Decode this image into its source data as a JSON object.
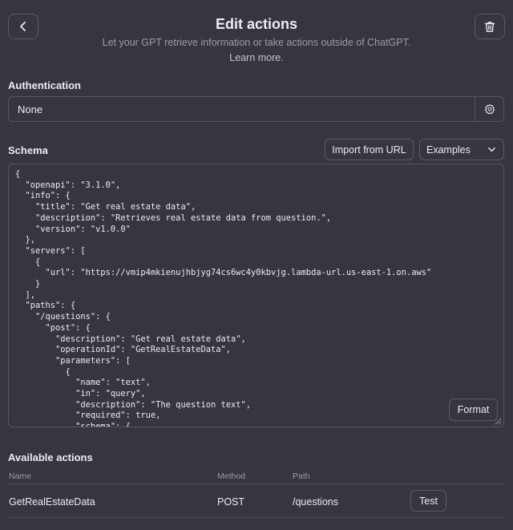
{
  "header": {
    "title": "Edit actions",
    "subtitle": "Let your GPT retrieve information or take actions outside of ChatGPT.",
    "learn_more": "Learn more."
  },
  "authentication": {
    "label": "Authentication",
    "value": "None"
  },
  "schema": {
    "label": "Schema",
    "import_label": "Import from URL",
    "examples_label": "Examples",
    "format_label": "Format",
    "code": "{\n  \"openapi\": \"3.1.0\",\n  \"info\": {\n    \"title\": \"Get real estate data\",\n    \"description\": \"Retrieves real estate data from question.\",\n    \"version\": \"v1.0.0\"\n  },\n  \"servers\": [\n    {\n      \"url\": \"https://vmip4mkienujhbjyg74cs6wc4y0kbvjg.lambda-url.us-east-1.on.aws\"\n    }\n  ],\n  \"paths\": {\n    \"/questions\": {\n      \"post\": {\n        \"description\": \"Get real estate data\",\n        \"operationId\": \"GetRealEstateData\",\n        \"parameters\": [\n          {\n            \"name\": \"text\",\n            \"in\": \"query\",\n            \"description\": \"The question text\",\n            \"required\": true,\n            \"schema\": {"
  },
  "available_actions": {
    "label": "Available actions",
    "columns": {
      "name": "Name",
      "method": "Method",
      "path": "Path"
    },
    "rows": [
      {
        "name": "GetRealEstateData",
        "method": "POST",
        "path": "/questions",
        "test_label": "Test"
      }
    ]
  },
  "icons": {
    "back": "chevron-left-icon",
    "trash": "trash-icon",
    "gear": "gear-icon",
    "dropdown": "chevron-down-icon"
  },
  "colors": {
    "background": "#35363f",
    "border": "#55565f",
    "text": "#ececf1",
    "muted": "#9b9ca8"
  }
}
